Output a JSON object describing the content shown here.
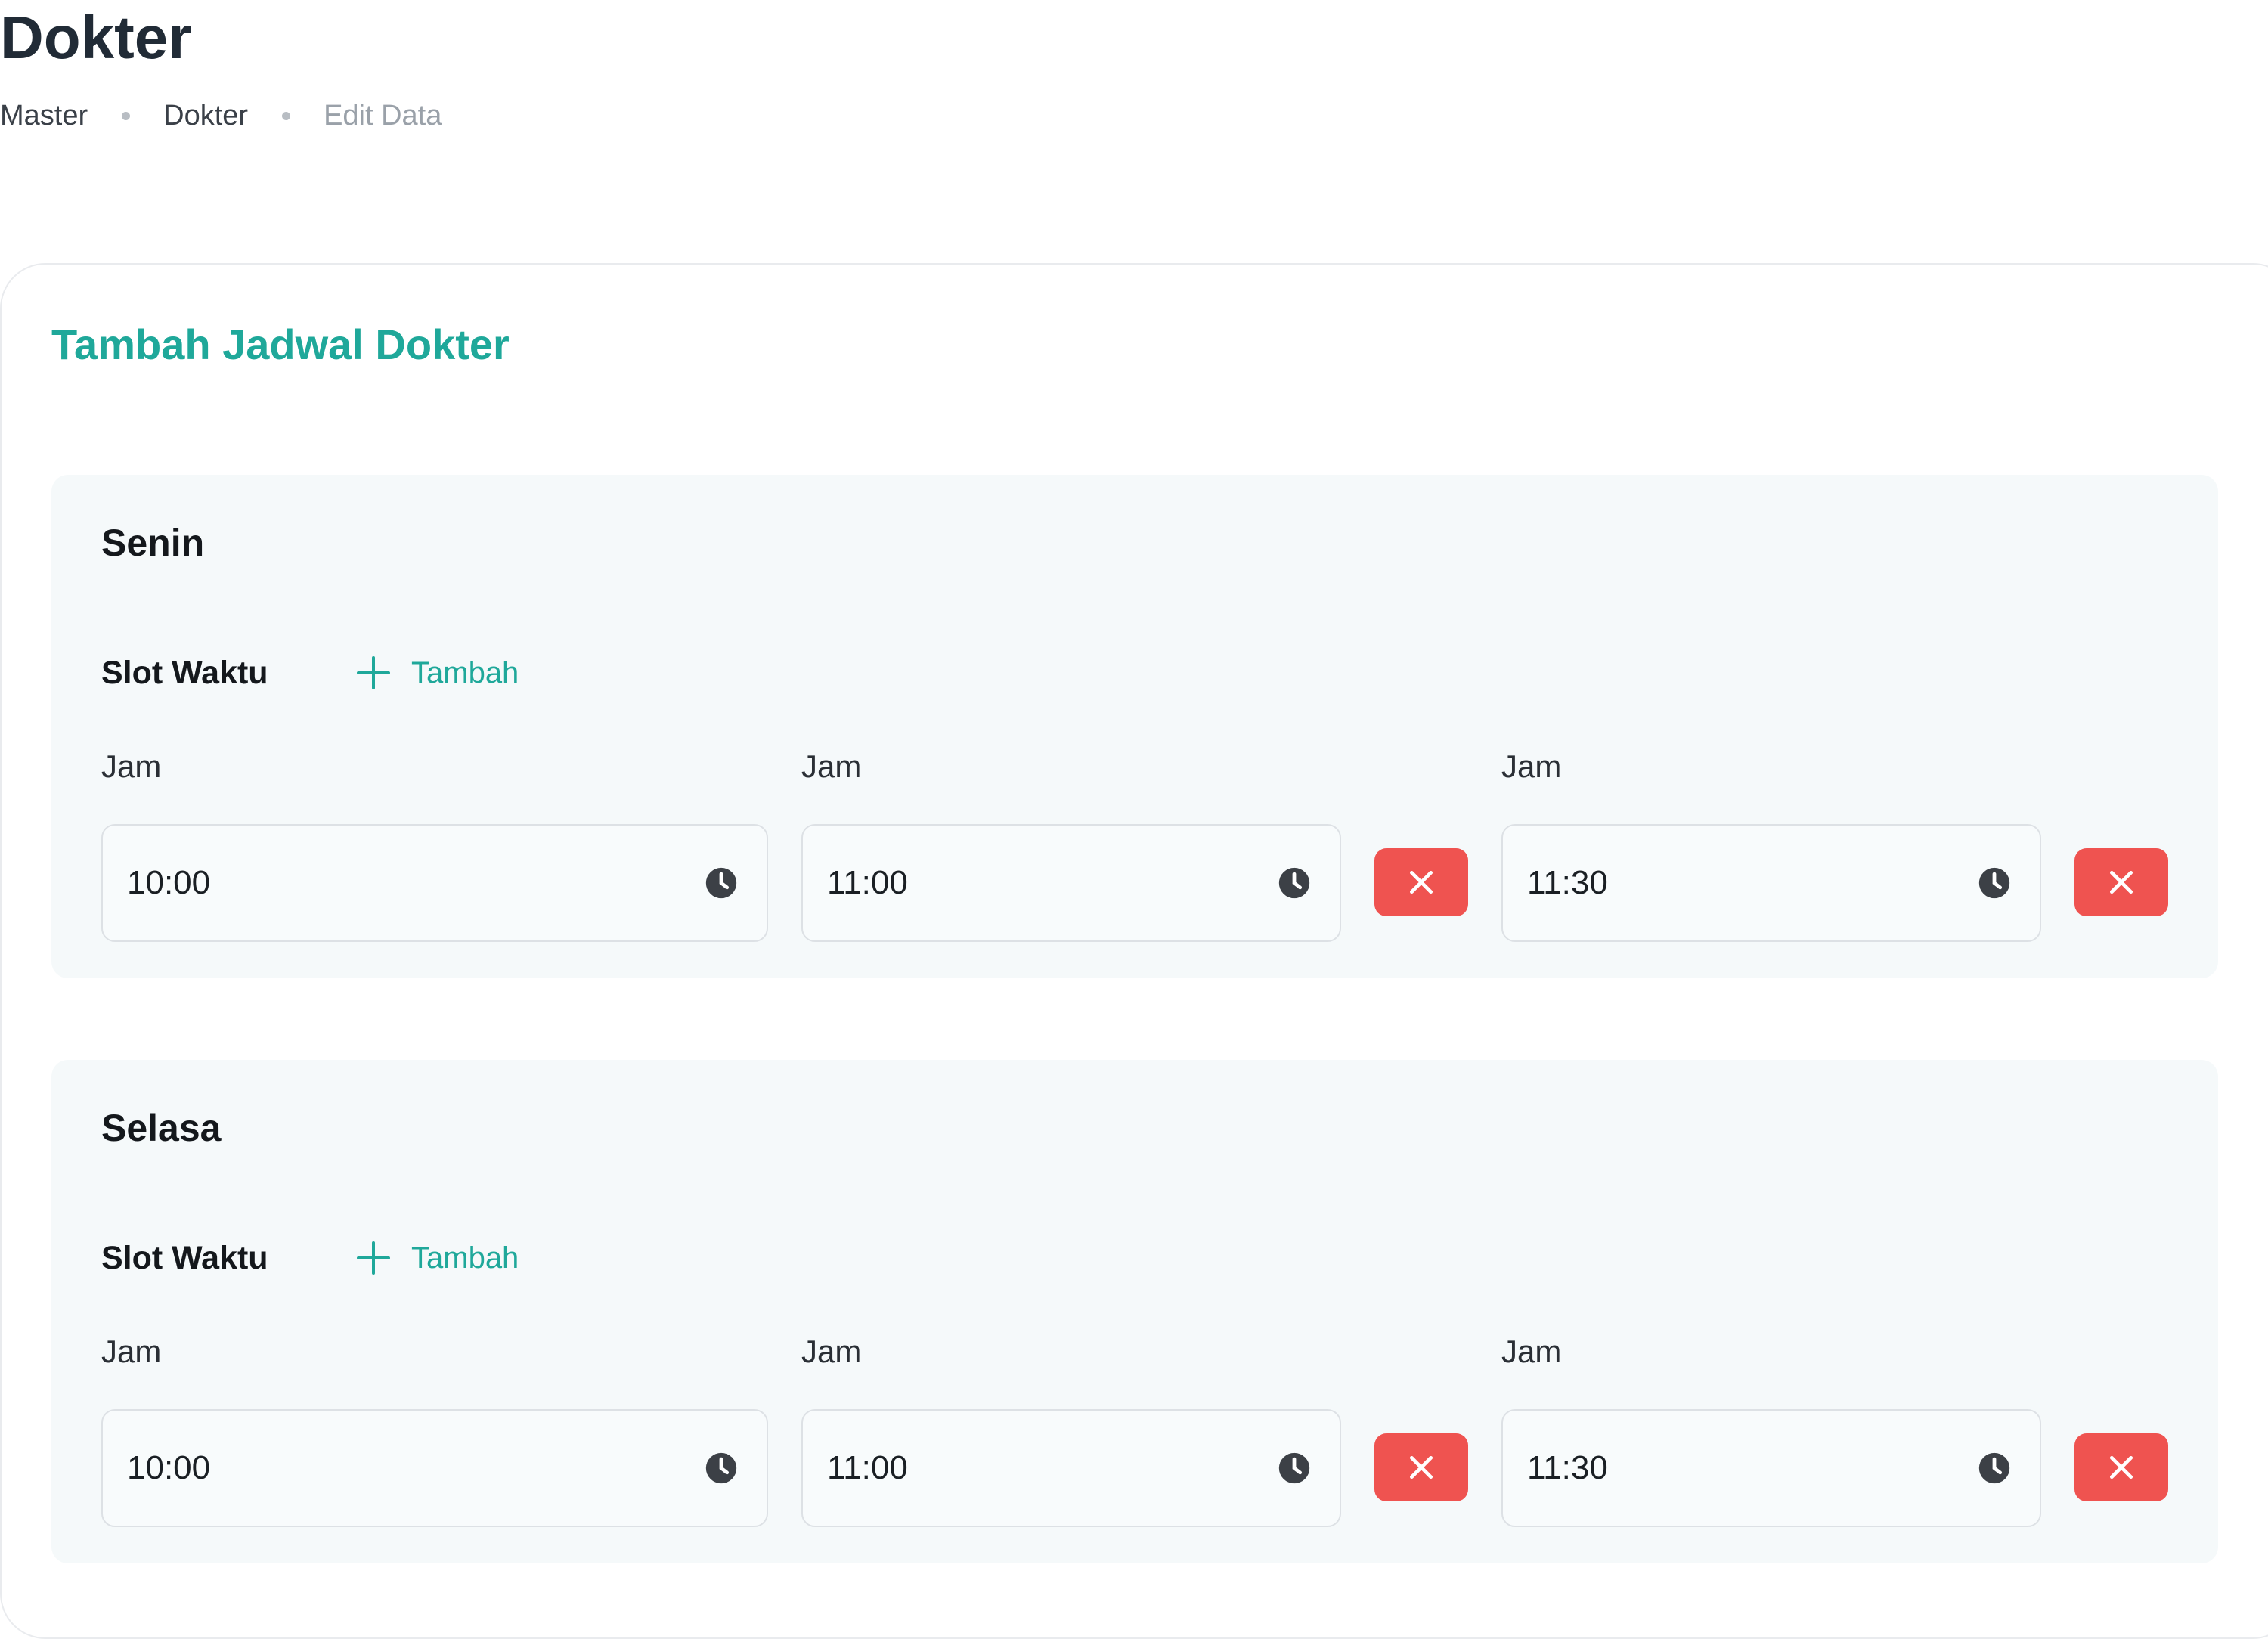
{
  "header": {
    "title": "Dokter",
    "breadcrumb": [
      "Master",
      "Dokter",
      "Edit Data"
    ]
  },
  "card": {
    "title": "Tambah Jadwal Dokter"
  },
  "colors": {
    "accent": "#1fa89a",
    "danger": "#ef5350",
    "section_bg": "#f5f9fa"
  },
  "days": [
    {
      "name": "Senin",
      "slot_label": "Slot Waktu",
      "add_label": "Tambah",
      "slots": [
        {
          "label": "Jam",
          "value": "10:00"
        },
        {
          "label": "Jam",
          "value": "11:00"
        },
        {
          "label": "Jam",
          "value": "11:30"
        }
      ]
    },
    {
      "name": "Selasa",
      "slot_label": "Slot Waktu",
      "add_label": "Tambah",
      "slots": [
        {
          "label": "Jam",
          "value": "10:00"
        },
        {
          "label": "Jam",
          "value": "11:00"
        },
        {
          "label": "Jam",
          "value": "11:30"
        }
      ]
    }
  ],
  "icons": {
    "field": "clock-icon",
    "delete": "close-icon",
    "add": "plus-icon"
  }
}
